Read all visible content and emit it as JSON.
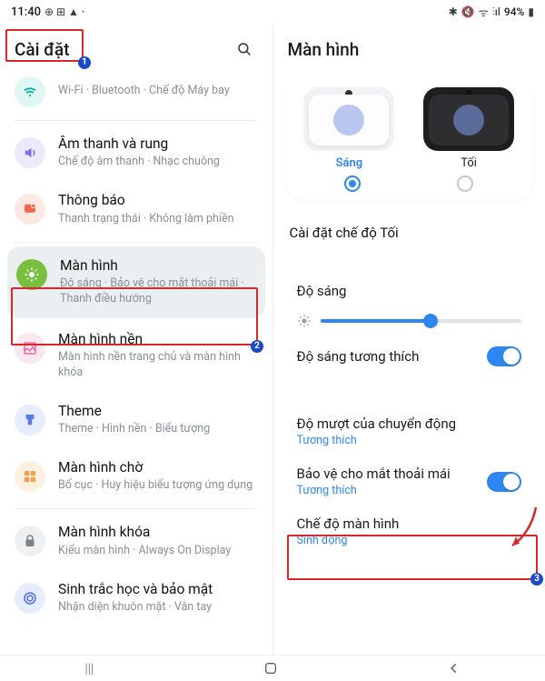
{
  "status": {
    "time": "11:40",
    "indicators_left": "⊕ ⊞ ▲ ·",
    "bluetooth": "✱",
    "mute": "🔇",
    "wifi": "ᯤ",
    "signal": "⫶ıl",
    "battery_pct": "94%",
    "battery_icon": "▮"
  },
  "left": {
    "title": "Cài đặt",
    "items": [
      {
        "icon": "ᯤ",
        "cls": "ic-teal",
        "title": "Wi-Fi · Bluetooth · Chế độ Máy bay",
        "sub": "",
        "small": true
      },
      {
        "icon": "🔊",
        "cls": "ic-purple",
        "title": "Âm thanh và rung",
        "sub": "Chế độ âm thanh · Nhạc chuông"
      },
      {
        "icon": "●●",
        "cls": "ic-red",
        "title": "Thông báo",
        "sub": "Thanh trạng thái · Không làm phiền"
      },
      {
        "icon": "☀",
        "cls": "ic-green",
        "title": "Màn hình",
        "sub": "Độ sáng · Bảo vệ cho mắt thoải mái · Thanh điều hướng",
        "sel": true
      },
      {
        "icon": "🖼",
        "cls": "ic-pink",
        "title": "Màn hình nền",
        "sub": "Màn hình nền trang chủ và màn hình khóa"
      },
      {
        "icon": "🎨",
        "cls": "ic-blue2",
        "title": "Theme",
        "sub": "Theme · Hình nền · Biểu tượng"
      },
      {
        "icon": "⊞",
        "cls": "ic-orange",
        "title": "Màn hình chờ",
        "sub": "Bố cục · Huy hiệu biểu tượng ứng dụng"
      },
      {
        "icon": "🔒",
        "cls": "ic-gray",
        "title": "Màn hình khóa",
        "sub": "Kiểu màn hình · Always On Display"
      },
      {
        "icon": "☉",
        "cls": "ic-navy",
        "title": "Sinh trắc học và bảo mật",
        "sub": "Nhận diện khuôn mặt · Vân tay"
      }
    ]
  },
  "right": {
    "title": "Màn hình",
    "theme_light": "Sáng",
    "theme_dark": "Tối",
    "dark_settings": "Cài đặt chế độ Tối",
    "brightness": "Độ sáng",
    "adaptive": "Độ sáng tương thích",
    "motion_title": "Độ mượt của chuyển động",
    "motion_sub": "Tương thích",
    "eye_title": "Bảo vệ cho mắt thoải mái",
    "eye_sub": "Tương thích",
    "screen_mode_title": "Chế độ màn hình",
    "screen_mode_sub": "Sinh động"
  },
  "nav": {
    "recent": "|||",
    "home": "◯",
    "back": "⟨"
  },
  "annotations": {
    "b1": "1",
    "b2": "2",
    "b3": "3"
  }
}
